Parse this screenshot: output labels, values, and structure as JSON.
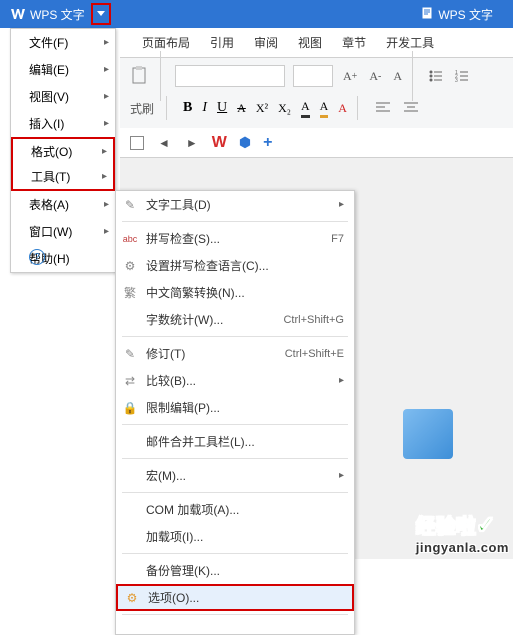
{
  "titlebar": {
    "app_name": "WPS 文字",
    "doc_name": "WPS 文字"
  },
  "menu": {
    "items": [
      {
        "label": "文件(F)",
        "has_arrow": true
      },
      {
        "label": "编辑(E)",
        "has_arrow": true
      },
      {
        "label": "视图(V)",
        "has_arrow": true
      },
      {
        "label": "插入(I)",
        "has_arrow": true
      },
      {
        "label": "格式(O)",
        "has_arrow": true
      },
      {
        "label": "工具(T)",
        "has_arrow": true,
        "highlight": true
      },
      {
        "label": "表格(A)",
        "has_arrow": true
      },
      {
        "label": "窗口(W)",
        "has_arrow": true
      },
      {
        "label": "帮助(H)",
        "has_arrow": false
      }
    ]
  },
  "tabs": [
    "页面布局",
    "引用",
    "审阅",
    "视图",
    "章节",
    "开发工具"
  ],
  "ribbon": {
    "format_brush": "式刷",
    "bold": "B",
    "italic": "I",
    "underline": "U",
    "strike": "A",
    "super": "X²",
    "sub": "X₂",
    "font_a1": "A",
    "font_a2": "A"
  },
  "submenu": {
    "items": [
      {
        "icon": "tools",
        "label": "文字工具(D)",
        "arrow": true
      },
      {
        "icon": "abc",
        "label": "拼写检查(S)...",
        "shortcut": "F7"
      },
      {
        "icon": "gear",
        "label": "设置拼写检查语言(C)..."
      },
      {
        "icon": "cn",
        "label": "中文简繁转换(N)..."
      },
      {
        "label": "字数统计(W)...",
        "shortcut": "Ctrl+Shift+G"
      },
      {
        "icon": "edit",
        "label": "修订(T)",
        "shortcut": "Ctrl+Shift+E"
      },
      {
        "icon": "compare",
        "label": "比较(B)...",
        "arrow": true
      },
      {
        "icon": "lock",
        "label": "限制编辑(P)..."
      },
      {
        "label": "邮件合并工具栏(L)..."
      },
      {
        "label": "宏(M)...",
        "arrow": true
      },
      {
        "label": "COM 加载项(A)..."
      },
      {
        "label": "加载项(I)..."
      },
      {
        "label": "备份管理(K)..."
      },
      {
        "icon": "settings",
        "label": "选项(O)...",
        "highlight": true
      }
    ]
  },
  "watermark": {
    "line1": "经验啦",
    "check": "✓",
    "line2": "jingyanla.com"
  }
}
